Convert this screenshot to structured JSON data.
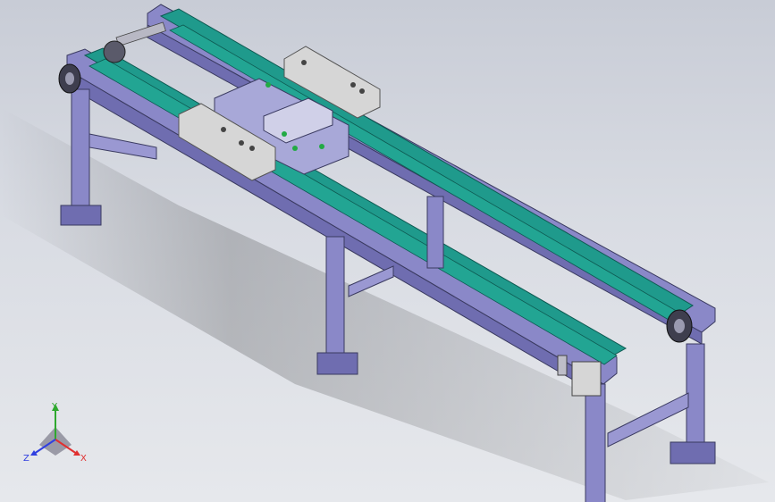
{
  "viewport": {
    "background_top": "#c8ccd6",
    "background_bottom": "#e6e8ec"
  },
  "model": {
    "frame_color": "#8a88c8",
    "frame_dark": "#6f6db0",
    "belt_color": "#1f9a8c",
    "block_color": "#d6d6d6"
  },
  "triad": {
    "x_label": "X",
    "y_label": "Y",
    "z_label": "Z",
    "x_color": "#e03030",
    "y_color": "#2ea82e",
    "z_color": "#3040e0"
  }
}
